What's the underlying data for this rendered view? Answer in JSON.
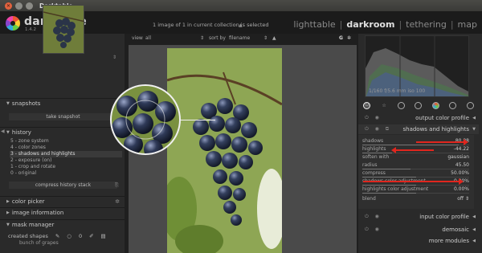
{
  "window": {
    "title": "Darktable"
  },
  "app": {
    "name": "darktable",
    "version": "1.4.2"
  },
  "header": {
    "collection_info": "1 image of 1 in current collection is selected",
    "views": [
      "lighttable",
      "darkroom",
      "tethering",
      "map"
    ],
    "active_view": "darkroom",
    "separator": "|"
  },
  "filterbar": {
    "view_label": "view",
    "view_value": "all",
    "sort_label": "sort by",
    "sort_value": "filename",
    "g_label": "G"
  },
  "left_panel": {
    "snapshots": {
      "title": "snapshots",
      "button": "take snapshot"
    },
    "history": {
      "title": "history",
      "items": [
        "5 - zone system",
        "4 - color zones",
        "3 - shadows and highlights",
        "2 - exposure  (on)",
        "1 - crop and rotate",
        "0 - original"
      ],
      "selected_index": 2,
      "compress_button": "compress history stack"
    },
    "color_picker": {
      "title": "color picker"
    },
    "image_information": {
      "title": "image information"
    },
    "mask_manager": {
      "title": "mask manager",
      "created_shapes": "created shapes",
      "sub_item": "bunch of grapes"
    }
  },
  "right_panel": {
    "exif": "1/160 f/5.6 mm iso 100",
    "modules": {
      "output_color_profile": "output color profile",
      "shadows_and_highlights": "shadows and highlights",
      "input_color_profile": "input color profile",
      "demosaic": "demosaic",
      "more_modules": "more modules"
    },
    "params": [
      {
        "label": "shadows",
        "value": "80.88",
        "fill": 0.9
      },
      {
        "label": "highlights",
        "value": "-44.22",
        "fill": 0.28
      },
      {
        "label": "soften with",
        "value": "gaussian",
        "fill": 0
      },
      {
        "label": "radius",
        "value": "45.50",
        "fill": 0.45
      },
      {
        "label": "compress",
        "value": "50.00%",
        "fill": 0.5
      },
      {
        "label": "shadows color adjustment",
        "value": "0.80%",
        "fill": 0.5
      },
      {
        "label": "highlights color adjustment",
        "value": "0.00%",
        "fill": 0.5
      },
      {
        "label": "blend",
        "value": "off",
        "fill": 0
      }
    ]
  },
  "colors": {
    "accent_arrow": "#e0261e",
    "title_close": "#e2623e"
  }
}
